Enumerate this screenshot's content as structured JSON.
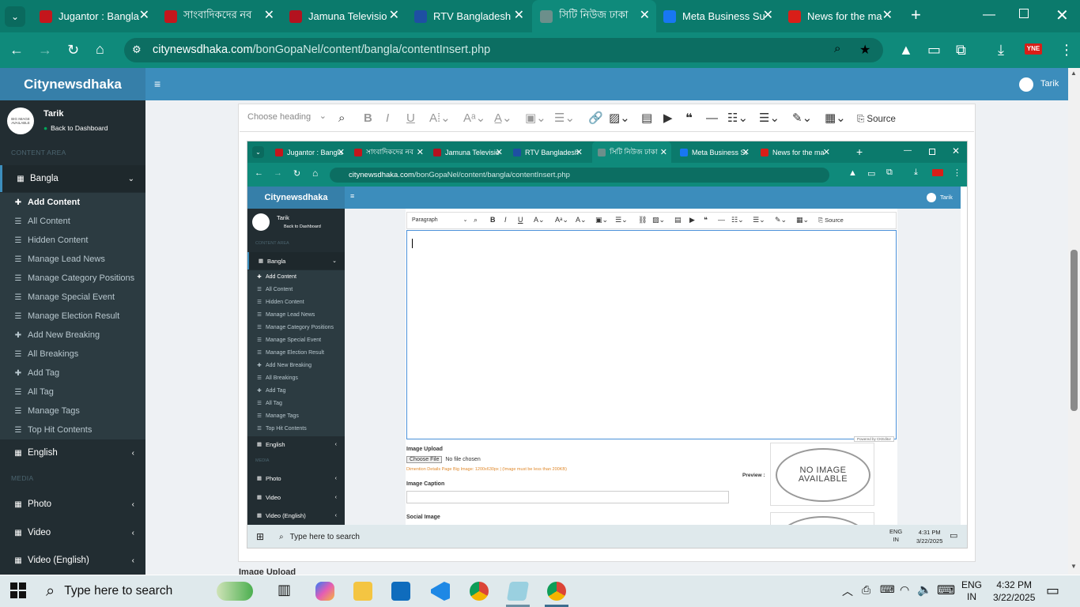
{
  "browser": {
    "tabs": [
      {
        "title": "Jugantor : Bangla",
        "fav": "#c4161c"
      },
      {
        "title": "সাংবাদিকদের নব",
        "fav": "#c4161c"
      },
      {
        "title": "Jamuna Televisio",
        "fav": "#b3121f"
      },
      {
        "title": "RTV Bangladesh",
        "fav": "#1e4fa3"
      },
      {
        "title": "সিটি নিউজ ঢাকা",
        "fav": "#6c8f8b",
        "active": true
      },
      {
        "title": "Meta Business Su",
        "fav": "#1877f2"
      },
      {
        "title": "News for the ma",
        "fav": "#d91e18"
      }
    ],
    "url_host": "citynewsdhaka.com",
    "url_path": "/bonGopaNel/content/bangla/contentInsert.php",
    "ext_badge": "YNE"
  },
  "admin": {
    "brand": "Citynewsdhaka",
    "user_name": "Tarik",
    "back_link": "Back to Dashboard",
    "content_area_label": "CONTENT AREA",
    "media_label": "MEDIA",
    "bangla_label": "Bangla",
    "menu": [
      {
        "label": "Add Content",
        "icon": "plus"
      },
      {
        "label": "All Content",
        "icon": "list"
      },
      {
        "label": "Hidden Content",
        "icon": "list"
      },
      {
        "label": "Manage Lead News",
        "icon": "list"
      },
      {
        "label": "Manage Category Positions",
        "icon": "list"
      },
      {
        "label": "Manage Special Event",
        "icon": "list"
      },
      {
        "label": "Manage Election Result",
        "icon": "list"
      },
      {
        "label": "Add New Breaking",
        "icon": "plus"
      },
      {
        "label": "All Breakings",
        "icon": "list"
      },
      {
        "label": "Add Tag",
        "icon": "plus"
      },
      {
        "label": "All Tag",
        "icon": "list"
      },
      {
        "label": "Manage Tags",
        "icon": "list"
      },
      {
        "label": "Top Hit Contents",
        "icon": "list"
      }
    ],
    "english_label": "English",
    "photo_label": "Photo",
    "video_label": "Video",
    "video_en_label": "Video (English)",
    "avatar_text": "BIG IMAGE AVAILABLE"
  },
  "editor": {
    "heading_placeholder": "Choose heading",
    "source_label": "Source",
    "bottom_label": "Image Upload"
  },
  "inner": {
    "paragraph_label": "Paragraph",
    "source_label": "Source",
    "image_upload_label": "Image Upload",
    "choose_file": "Choose File",
    "no_file": "No file chosen",
    "dimension_note": "Dimention Details Page Big Image: 1200x630px | (Image must be less than 200KB)",
    "preview_label": "Preview :",
    "no_image_line1": "NO IMAGE",
    "no_image_line2": "AVAILABLE",
    "caption_label": "Image Caption",
    "social_label": "Social Image",
    "powered_by": "Powered by CKEditor",
    "search_placeholder": "Type here to search",
    "lang": "ENG",
    "region": "IN",
    "time": "4:31 PM",
    "date": "3/22/2025"
  },
  "taskbar": {
    "search_placeholder": "Type here to search",
    "lang": "ENG",
    "region": "IN",
    "time": "4:32 PM",
    "date": "3/22/2025"
  }
}
